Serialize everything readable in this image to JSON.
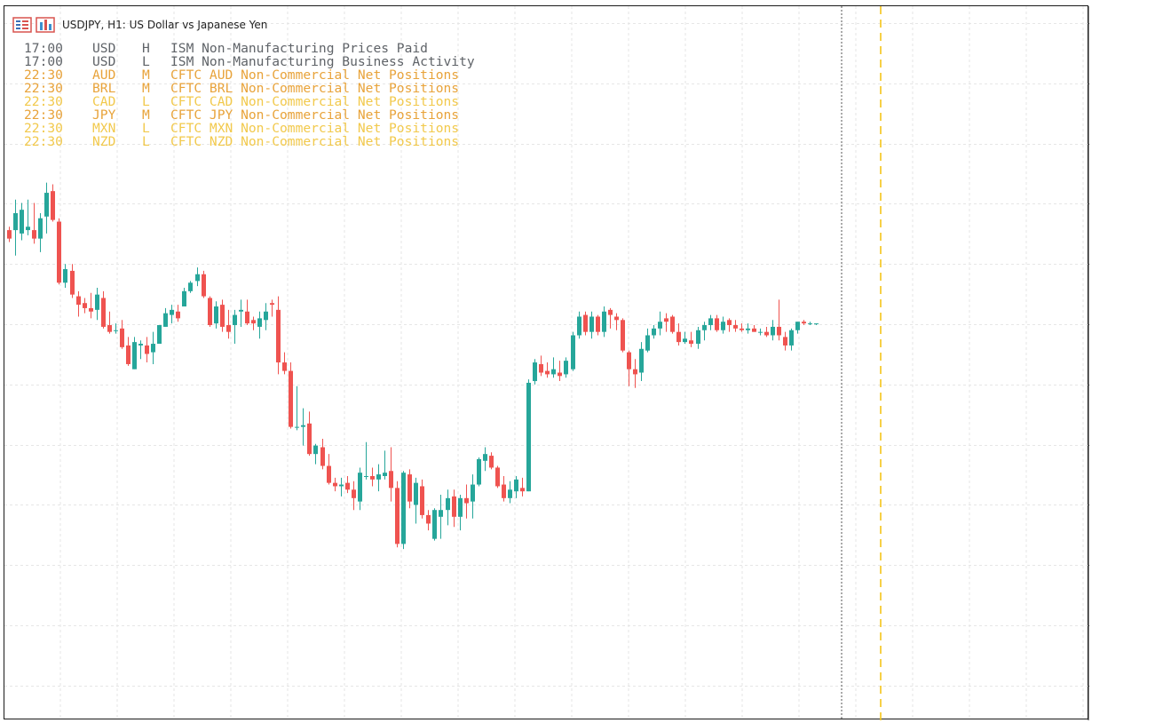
{
  "header": {
    "title": "USDJPY, H1:  US Dollar vs Japanese Yen",
    "icons": [
      "calendar-grid-icon",
      "bar-chart-icon"
    ]
  },
  "events": [
    {
      "time": "17:00",
      "currency": "USD",
      "importance": "H",
      "name": "ISM Non-Manufacturing Prices Paid",
      "color": "#5f6368"
    },
    {
      "time": "17:00",
      "currency": "USD",
      "importance": "L",
      "name": "ISM Non-Manufacturing Business Activity",
      "color": "#5f6368"
    },
    {
      "time": "22:30",
      "currency": "AUD",
      "importance": "M",
      "name": "CFTC AUD Non-Commercial Net Positions",
      "color": "#e8a33a"
    },
    {
      "time": "22:30",
      "currency": "BRL",
      "importance": "M",
      "name": "CFTC BRL Non-Commercial Net Positions",
      "color": "#e8a33a"
    },
    {
      "time": "22:30",
      "currency": "CAD",
      "importance": "L",
      "name": "CFTC CAD Non-Commercial Net Positions",
      "color": "#f2c94c"
    },
    {
      "time": "22:30",
      "currency": "JPY",
      "importance": "M",
      "name": "CFTC JPY Non-Commercial Net Positions",
      "color": "#e8a33a"
    },
    {
      "time": "22:30",
      "currency": "MXN",
      "importance": "L",
      "name": "CFTC MXN Non-Commercial Net Positions",
      "color": "#f2c94c"
    },
    {
      "time": "22:30",
      "currency": "NZD",
      "importance": "L",
      "name": "CFTC NZD Non-Commercial Net Positions",
      "color": "#f2c94c"
    }
  ],
  "chart_data": {
    "type": "candlestick",
    "symbol": "USDJPY",
    "timeframe": "H1",
    "title": "USDJPY, H1:  US Dollar vs Japanese Yen",
    "ylim": [
      157.31,
      161.52
    ],
    "yticks": [
      "161.420",
      "161.065",
      "160.710",
      "160.355",
      "160.000",
      "159.645",
      "159.290",
      "158.935",
      "158.580",
      "158.225",
      "157.870",
      "157.515"
    ],
    "grid": true,
    "colors": {
      "up": "#26a69a",
      "down": "#ef5350",
      "grid": "#e6e6e6",
      "event_line": "#f5c518",
      "period_separator": "#555555"
    },
    "candles": [
      [
        160.2,
        160.22,
        160.13,
        160.15
      ],
      [
        160.2,
        160.38,
        160.05,
        160.3
      ],
      [
        160.18,
        160.36,
        160.14,
        160.32
      ],
      [
        160.2,
        160.38,
        160.17,
        160.22
      ],
      [
        160.2,
        160.36,
        160.12,
        160.15
      ],
      [
        160.15,
        160.3,
        160.07,
        160.27
      ],
      [
        160.28,
        160.48,
        160.18,
        160.42
      ],
      [
        160.43,
        160.47,
        160.25,
        160.26
      ],
      [
        160.25,
        160.27,
        159.88,
        159.89
      ],
      [
        159.89,
        160.0,
        159.86,
        159.97
      ],
      [
        159.96,
        160.0,
        159.8,
        159.82
      ],
      [
        159.81,
        159.84,
        159.69,
        159.76
      ],
      [
        159.77,
        159.8,
        159.71,
        159.74
      ],
      [
        159.74,
        159.83,
        159.68,
        159.72
      ],
      [
        159.73,
        159.86,
        159.67,
        159.82
      ],
      [
        159.8,
        159.84,
        159.62,
        159.63
      ],
      [
        159.64,
        159.72,
        159.59,
        159.6
      ],
      [
        159.61,
        159.65,
        159.59,
        159.61
      ],
      [
        159.62,
        159.67,
        159.5,
        159.51
      ],
      [
        159.52,
        159.57,
        159.4,
        159.41
      ],
      [
        159.38,
        159.57,
        159.38,
        159.54
      ],
      [
        159.52,
        159.55,
        159.44,
        159.53
      ],
      [
        159.52,
        159.57,
        159.42,
        159.47
      ],
      [
        159.48,
        159.6,
        159.41,
        159.53
      ],
      [
        159.53,
        159.64,
        159.53,
        159.64
      ],
      [
        159.63,
        159.74,
        159.63,
        159.71
      ],
      [
        159.7,
        159.76,
        159.65,
        159.73
      ],
      [
        159.72,
        159.76,
        159.66,
        159.68
      ],
      [
        159.75,
        159.86,
        159.75,
        159.84
      ],
      [
        159.84,
        159.9,
        159.83,
        159.89
      ],
      [
        159.9,
        159.98,
        159.87,
        159.94
      ],
      [
        159.94,
        159.96,
        159.8,
        159.81
      ],
      [
        159.8,
        159.81,
        159.63,
        159.64
      ],
      [
        159.65,
        159.78,
        159.62,
        159.75
      ],
      [
        159.76,
        159.79,
        159.6,
        159.63
      ],
      [
        159.64,
        159.73,
        159.56,
        159.6
      ],
      [
        159.64,
        159.73,
        159.53,
        159.7
      ],
      [
        159.72,
        159.79,
        159.63,
        159.73
      ],
      [
        159.72,
        159.79,
        159.64,
        159.65
      ],
      [
        159.67,
        159.69,
        159.61,
        159.65
      ],
      [
        159.63,
        159.72,
        159.56,
        159.68
      ],
      [
        159.67,
        159.77,
        159.61,
        159.72
      ],
      [
        159.77,
        159.79,
        159.69,
        159.76
      ],
      [
        159.73,
        159.81,
        159.35,
        159.42
      ],
      [
        159.42,
        159.48,
        159.35,
        159.37
      ],
      [
        159.37,
        159.42,
        159.03,
        159.04
      ],
      [
        159.04,
        159.28,
        159.02,
        159.04
      ],
      [
        159.04,
        159.15,
        158.93,
        159.05
      ],
      [
        159.06,
        159.13,
        158.87,
        158.88
      ],
      [
        158.88,
        158.94,
        158.82,
        158.93
      ],
      [
        158.92,
        158.97,
        158.79,
        158.81
      ],
      [
        158.81,
        158.88,
        158.7,
        158.71
      ],
      [
        158.71,
        158.74,
        158.66,
        158.69
      ],
      [
        158.69,
        158.74,
        158.63,
        158.7
      ],
      [
        158.71,
        158.75,
        158.65,
        158.67
      ],
      [
        158.67,
        158.72,
        158.55,
        158.62
      ],
      [
        158.6,
        158.8,
        158.55,
        158.77
      ],
      [
        158.75,
        158.95,
        158.73,
        158.75
      ],
      [
        158.75,
        158.8,
        158.69,
        158.73
      ],
      [
        158.73,
        158.82,
        158.66,
        158.76
      ],
      [
        158.75,
        158.9,
        158.73,
        158.77
      ],
      [
        158.78,
        158.92,
        158.6,
        158.68
      ],
      [
        158.68,
        158.72,
        158.33,
        158.35
      ],
      [
        158.35,
        158.78,
        158.32,
        158.77
      ],
      [
        158.76,
        158.79,
        158.56,
        158.6
      ],
      [
        158.58,
        158.74,
        158.47,
        158.71
      ],
      [
        158.69,
        158.73,
        158.5,
        158.52
      ],
      [
        158.52,
        158.55,
        158.43,
        158.47
      ],
      [
        158.38,
        158.56,
        158.37,
        158.55
      ],
      [
        158.51,
        158.64,
        158.38,
        158.55
      ],
      [
        158.55,
        158.67,
        158.46,
        158.62
      ],
      [
        158.63,
        158.67,
        158.45,
        158.51
      ],
      [
        158.51,
        158.64,
        158.43,
        158.62
      ],
      [
        158.62,
        158.7,
        158.5,
        158.59
      ],
      [
        158.6,
        158.76,
        158.5,
        158.7
      ],
      [
        158.7,
        158.86,
        158.69,
        158.85
      ],
      [
        158.84,
        158.92,
        158.78,
        158.88
      ],
      [
        158.87,
        158.89,
        158.79,
        158.8
      ],
      [
        158.8,
        158.81,
        158.68,
        158.69
      ],
      [
        158.7,
        158.75,
        158.6,
        158.62
      ],
      [
        158.62,
        158.72,
        158.59,
        158.67
      ],
      [
        158.66,
        158.75,
        158.62,
        158.73
      ],
      [
        158.68,
        158.74,
        158.63,
        158.66
      ],
      [
        158.66,
        159.32,
        158.66,
        159.3
      ],
      [
        159.31,
        159.44,
        159.29,
        159.42
      ],
      [
        159.41,
        159.46,
        159.34,
        159.36
      ],
      [
        159.37,
        159.42,
        159.33,
        159.35
      ],
      [
        159.35,
        159.45,
        159.33,
        159.38
      ],
      [
        159.36,
        159.43,
        159.31,
        159.34
      ],
      [
        159.35,
        159.45,
        159.33,
        159.43
      ],
      [
        159.38,
        159.6,
        159.37,
        159.58
      ],
      [
        159.58,
        159.72,
        159.56,
        159.69
      ],
      [
        159.7,
        159.72,
        159.58,
        159.6
      ],
      [
        159.6,
        159.72,
        159.56,
        159.69
      ],
      [
        159.69,
        159.7,
        159.58,
        159.6
      ],
      [
        159.6,
        159.75,
        159.57,
        159.72
      ],
      [
        159.73,
        159.74,
        159.62,
        159.7
      ],
      [
        159.69,
        159.71,
        159.61,
        159.67
      ],
      [
        159.67,
        159.68,
        159.48,
        159.49
      ],
      [
        159.48,
        159.49,
        159.28,
        159.38
      ],
      [
        159.38,
        159.44,
        159.27,
        159.35
      ],
      [
        159.36,
        159.54,
        159.31,
        159.5
      ],
      [
        159.49,
        159.62,
        159.48,
        159.58
      ],
      [
        159.58,
        159.64,
        159.56,
        159.62
      ],
      [
        159.62,
        159.72,
        159.58,
        159.66
      ],
      [
        159.68,
        159.71,
        159.6,
        159.66
      ],
      [
        159.69,
        159.7,
        159.59,
        159.6
      ],
      [
        159.6,
        159.65,
        159.52,
        159.54
      ],
      [
        159.54,
        159.6,
        159.53,
        159.56
      ],
      [
        159.55,
        159.6,
        159.51,
        159.53
      ],
      [
        159.53,
        159.63,
        159.5,
        159.61
      ],
      [
        159.61,
        159.66,
        159.55,
        159.64
      ],
      [
        159.64,
        159.7,
        159.61,
        159.68
      ],
      [
        159.68,
        159.7,
        159.6,
        159.61
      ],
      [
        159.61,
        159.69,
        159.59,
        159.66
      ],
      [
        159.67,
        159.68,
        159.6,
        159.64
      ],
      [
        159.64,
        159.67,
        159.6,
        159.62
      ],
      [
        159.62,
        159.65,
        159.6,
        159.61
      ],
      [
        159.61,
        159.65,
        159.59,
        159.62
      ],
      [
        159.62,
        159.64,
        159.6,
        159.6
      ],
      [
        159.6,
        159.62,
        159.58,
        159.6
      ],
      [
        159.6,
        159.63,
        159.57,
        159.58
      ],
      [
        159.58,
        159.67,
        159.55,
        159.63
      ],
      [
        159.63,
        159.79,
        159.55,
        159.58
      ],
      [
        159.57,
        159.6,
        159.49,
        159.52
      ],
      [
        159.52,
        159.62,
        159.49,
        159.61
      ],
      [
        159.61,
        159.66,
        159.59,
        159.66
      ],
      [
        159.66,
        159.67,
        159.64,
        159.65
      ],
      [
        159.65,
        159.66,
        159.64,
        159.65
      ],
      [
        159.65,
        159.65,
        159.64,
        159.65
      ]
    ]
  }
}
